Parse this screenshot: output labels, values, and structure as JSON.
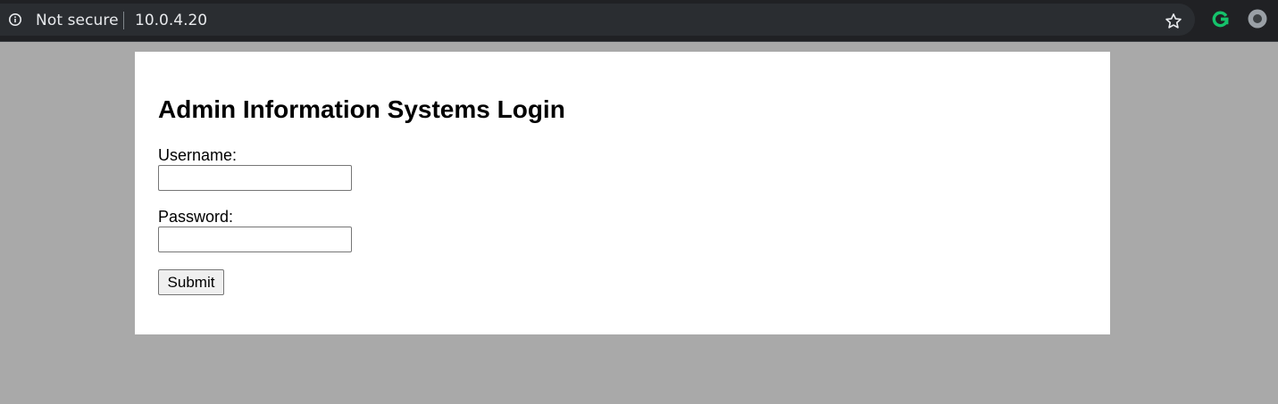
{
  "browser": {
    "security_label": "Not secure",
    "url": "10.0.4.20",
    "icons": {
      "info": "info-icon",
      "bookmark": "star-icon",
      "extension": "grammarly-extension-icon",
      "profile": "profile-icon"
    },
    "colors": {
      "toolbar": "#202124",
      "omnibox": "#2a2d31",
      "extension_green": "#15c26b"
    }
  },
  "page": {
    "background_color": "#a9a9a9",
    "card_color": "#ffffff",
    "title": "Admin Information Systems Login",
    "form": {
      "username_label": "Username:",
      "username_value": "",
      "password_label": "Password:",
      "password_value": "",
      "submit_label": "Submit"
    }
  }
}
